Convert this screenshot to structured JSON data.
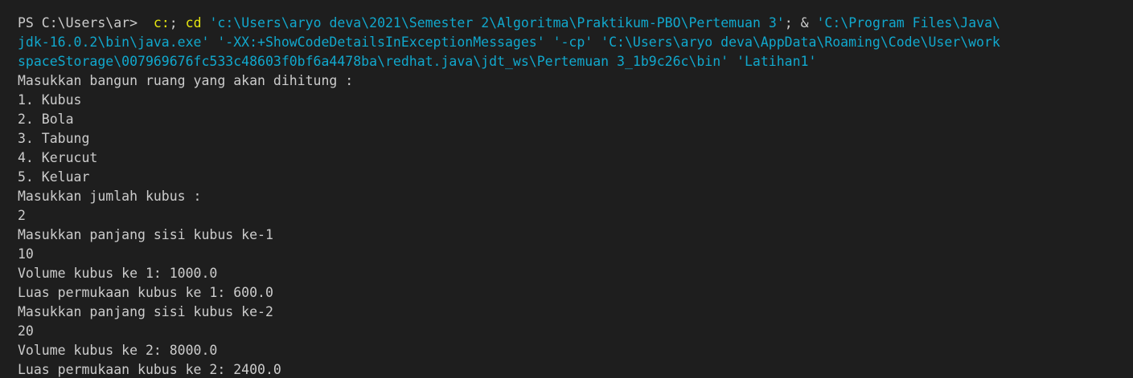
{
  "terminal": {
    "prompt": "PS C:\\Users\\ar> ",
    "command": {
      "line1_parts": [
        {
          "text": " ",
          "style": "plain"
        },
        {
          "text": "c:",
          "style": "kw"
        },
        {
          "text": "; ",
          "style": "plain"
        },
        {
          "text": "cd",
          "style": "kw"
        },
        {
          "text": " ",
          "style": "plain"
        },
        {
          "text": "'c:\\Users\\aryo deva\\2021\\Semester 2\\Algoritma\\Praktikum-PBO\\Pertemuan 3'",
          "style": "str"
        },
        {
          "text": "; & ",
          "style": "plain"
        },
        {
          "text": "'C:\\Program Files\\Java\\",
          "style": "str"
        }
      ],
      "line2": "jdk-16.0.2\\bin\\java.exe' '-XX:+ShowCodeDetailsInExceptionMessages' '-cp' 'C:\\Users\\aryo deva\\AppData\\Roaming\\Code\\User\\work",
      "line3": "spaceStorage\\007969676fc533c48603f0bf6a4478ba\\redhat.java\\jdt_ws\\Pertemuan 3_1b9c26c\\bin' 'Latihan1'"
    },
    "output": [
      "Masukkan bangun ruang yang akan dihitung :",
      "1. Kubus",
      "2. Bola",
      "3. Tabung",
      "4. Kerucut",
      "5. Keluar",
      "Masukkan jumlah kubus :",
      "2",
      "Masukkan panjang sisi kubus ke-1",
      "10",
      "Volume kubus ke 1: 1000.0",
      "Luas permukaan kubus ke 1: 600.0",
      "Masukkan panjang sisi kubus ke-2",
      "20",
      "Volume kubus ke 2: 8000.0",
      "Luas permukaan kubus ke 2: 2400.0"
    ]
  }
}
